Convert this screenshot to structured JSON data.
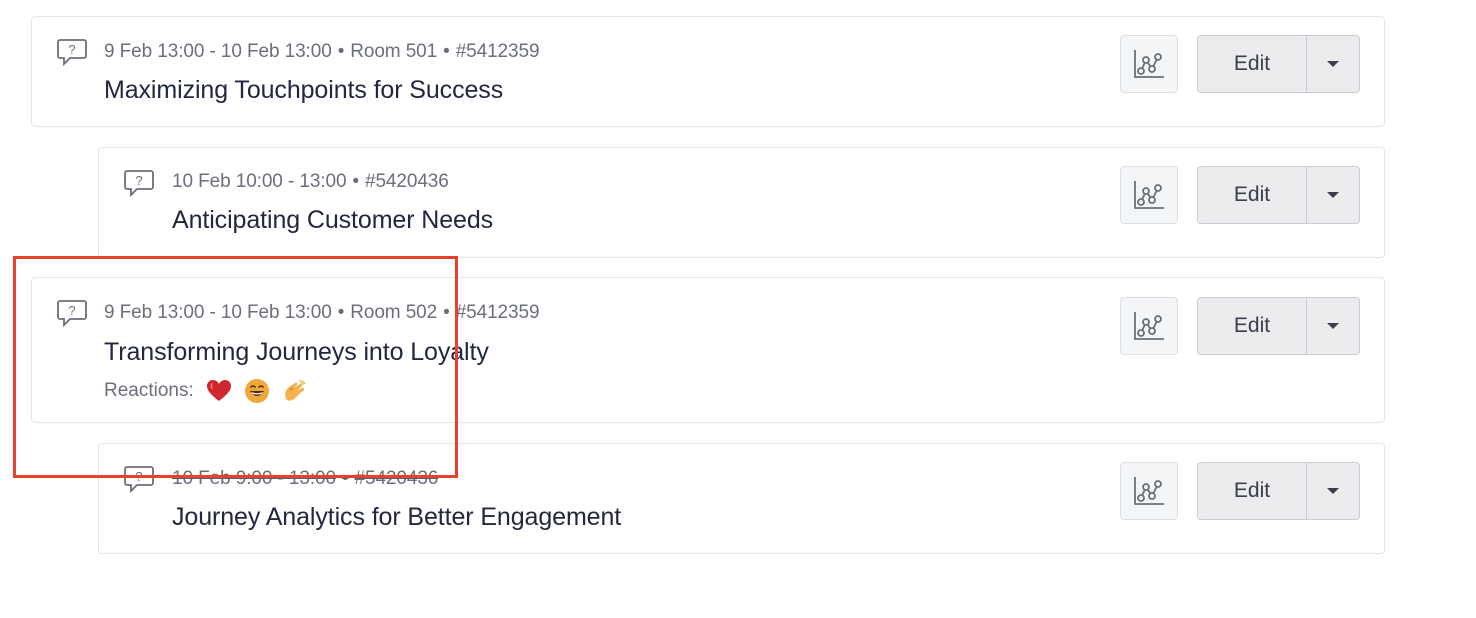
{
  "sessions": [
    {
      "meta": {
        "date": "9 Feb 13:00 - 10 Feb 13:00",
        "room": "Room 501",
        "id": "#5412359"
      },
      "title": "Maximizing Touchpoints for Success",
      "edit_label": "Edit",
      "icon": "question-bubble-icon"
    },
    {
      "meta": {
        "date": "10 Feb 10:00 - 13:00",
        "id": "#5420436"
      },
      "title": "Anticipating Customer Needs",
      "edit_label": "Edit",
      "icon": "question-bubble-icon"
    },
    {
      "meta": {
        "date": "9 Feb 13:00 - 10 Feb 13:00",
        "room": "Room 502",
        "id": "#5412359"
      },
      "title": "Transforming Journeys into Loyalty",
      "reactions_label": "Reactions:",
      "reactions": [
        "heart",
        "grinning-face",
        "clapping-hands"
      ],
      "edit_label": "Edit",
      "icon": "question-bubble-icon"
    },
    {
      "meta": {
        "date": "10 Feb 9:00 - 13:00",
        "id": "#5420436"
      },
      "title": "Journey Analytics for Better Engagement",
      "edit_label": "Edit",
      "icon": "question-bubble-icon",
      "struck": true
    }
  ],
  "colors": {
    "highlight": "#e8412c",
    "heart": "#d0272f",
    "emoji_face": "#f0a83a",
    "clap": "#f4b14d"
  },
  "separator": "•"
}
